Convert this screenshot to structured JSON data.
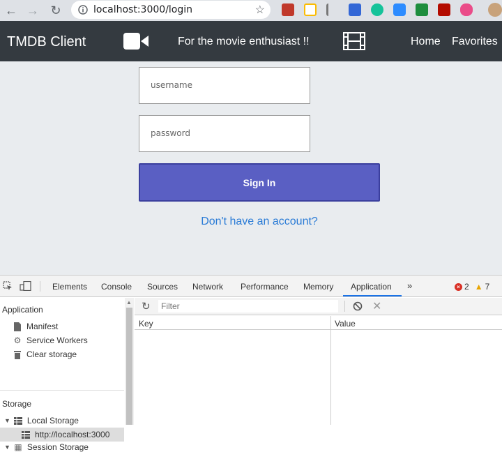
{
  "browser": {
    "url": "localhost:3000/login"
  },
  "navbar": {
    "brand": "TMDB Client",
    "tagline": "For the movie enthusiast !!",
    "links": [
      "Home",
      "Favorites"
    ]
  },
  "login": {
    "username_placeholder": "username",
    "password_placeholder": "password",
    "signin_label": "Sign In",
    "signup_link": "Don't have an account?"
  },
  "devtools": {
    "tabs": [
      "Elements",
      "Console",
      "Sources",
      "Network",
      "Performance",
      "Memory",
      "Application"
    ],
    "active_tab": "Application",
    "more": "»",
    "errors": "2",
    "warnings": "7",
    "filter_placeholder": "Filter",
    "sidebar": {
      "application_title": "Application",
      "items": [
        "Manifest",
        "Service Workers",
        "Clear storage"
      ],
      "storage_title": "Storage",
      "local_storage": "Local Storage",
      "local_storage_origin": "http://localhost:3000",
      "session_storage_partial": "Session Storage"
    },
    "table": {
      "key_header": "Key",
      "value_header": "Value"
    }
  }
}
